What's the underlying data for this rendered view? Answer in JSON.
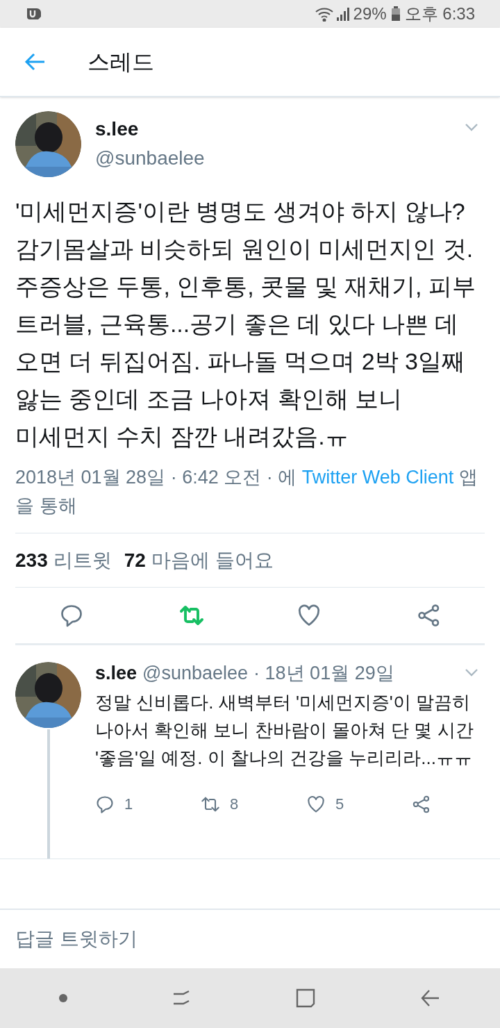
{
  "status_bar": {
    "battery": "29%",
    "time": "오후 6:33"
  },
  "header": {
    "title": "스레드"
  },
  "tweet": {
    "name": "s.lee",
    "handle": "@sunbaelee",
    "text": "'미세먼지증'이란 병명도 생겨야 하지 않나? 감기몸살과 비슷하되 원인이 미세먼지인 것. 주증상은 두통, 인후통, 콧물 및 재채기, 피부 트러블, 근육통...공기 좋은 데 있다 나쁜 데 오면 더 뒤집어짐. 파나돌 먹으며 2박 3일째 앓는 중인데 조금 나아져 확인해 보니 미세먼지 수치 잠깐 내려갔음.ㅠ",
    "date": "2018년 01월 28일 · 6:42 오전 · 에",
    "client": "Twitter Web Client",
    "client_suffix": "앱을 통해",
    "stats": [
      {
        "count": "233",
        "label": "리트윗"
      },
      {
        "count": "72",
        "label": "마음에 들어요"
      }
    ],
    "retweeted": true,
    "liked": false
  },
  "reply": {
    "name": "s.lee",
    "handle": "@sunbaelee",
    "date": "· 18년 01월 29일",
    "text": "정말 신비롭다. 새벽부터 '미세먼지증'이 말끔히 나아서 확인해 보니 찬바람이 몰아쳐 단 몇 시간 '좋음'일 예정. 이 찰나의 건강을 누리리라...ㅠㅠ",
    "actions": [
      {
        "kind": "reply",
        "count": "1"
      },
      {
        "kind": "retweet",
        "count": "8"
      },
      {
        "kind": "like",
        "count": "5"
      },
      {
        "kind": "share"
      }
    ],
    "retweeted": false,
    "liked": false
  },
  "composer": {
    "placeholder": "답글 트윗하기"
  }
}
